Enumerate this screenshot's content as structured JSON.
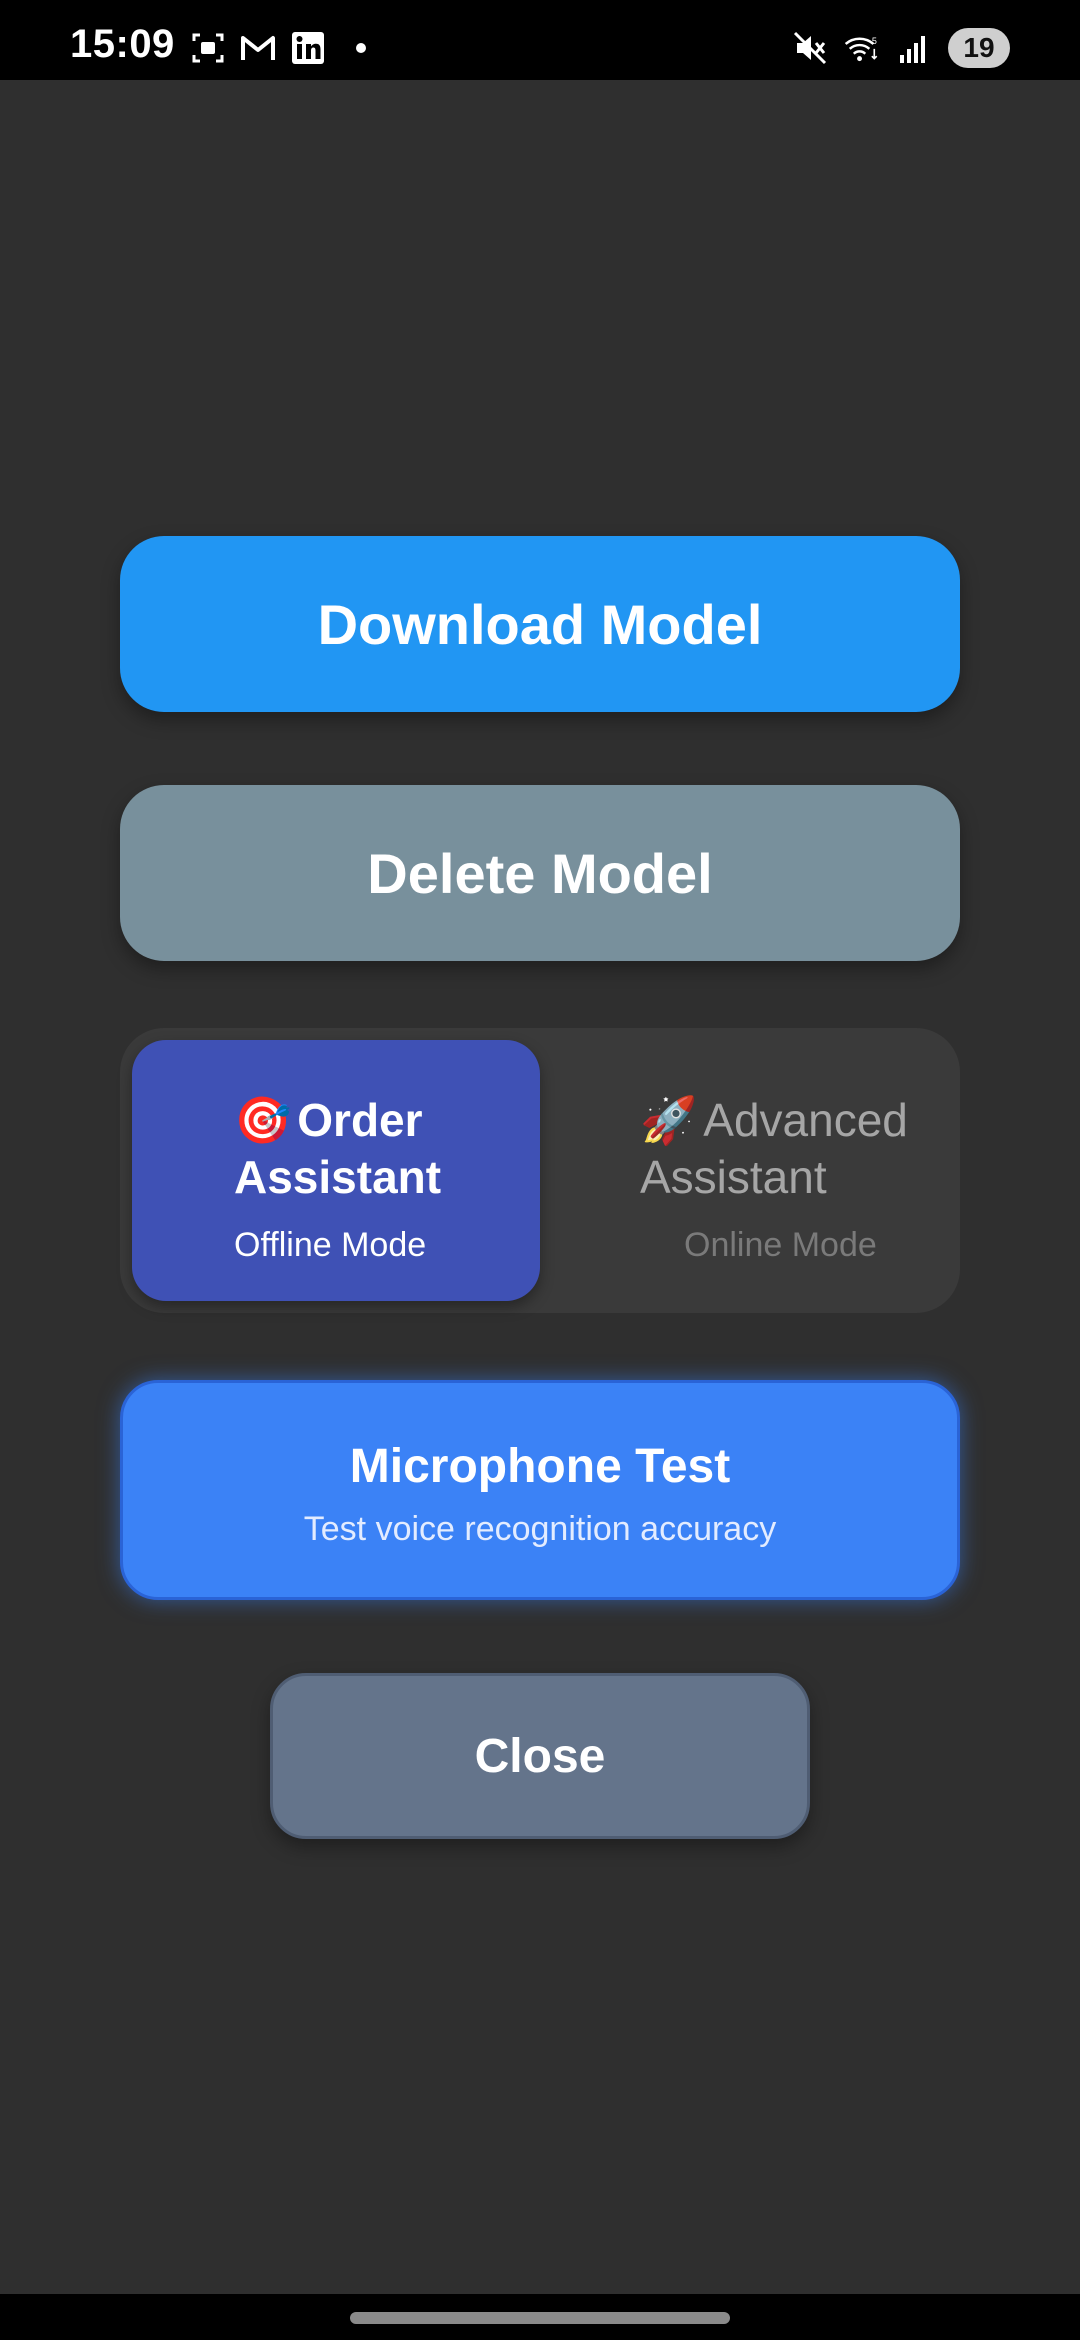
{
  "status_bar": {
    "time": "15:09",
    "left_icons": [
      "screenshot-icon",
      "gmail-icon",
      "linkedin-icon",
      "notification-dot-icon"
    ],
    "right_icons": [
      "mute-icon",
      "wifi-icon",
      "signal-icon"
    ],
    "battery": "19"
  },
  "actions": {
    "download_label": "Download Model",
    "delete_label": "Delete Model"
  },
  "mode_toggle": {
    "selected": "offline",
    "options": [
      {
        "emoji": "🎯",
        "title": "Order Assistant",
        "subtitle": "Offline Mode"
      },
      {
        "emoji": "🚀",
        "title": "Advanced Assistant",
        "subtitle": "Online Mode"
      }
    ]
  },
  "mic_test": {
    "title": "Microphone Test",
    "subtitle": "Test voice recognition accuracy"
  },
  "close_label": "Close",
  "colors": {
    "background": "#2f2f2f",
    "download": "#2196f3",
    "delete": "#78909c",
    "mode_selected": "#3f51b5",
    "mic": "#3b82f6",
    "close": "#64748b"
  }
}
